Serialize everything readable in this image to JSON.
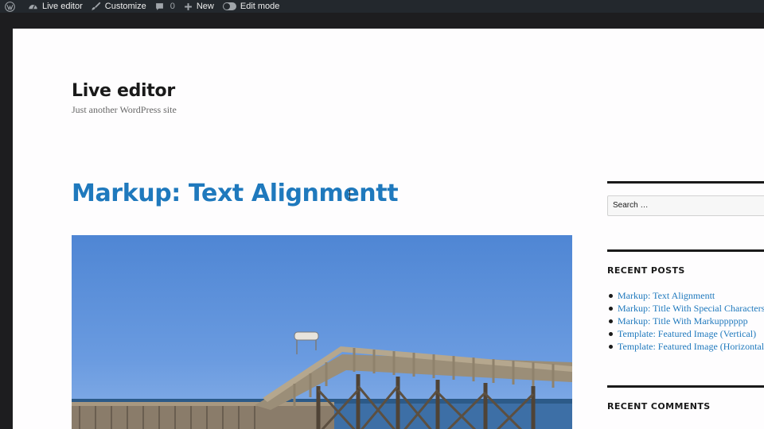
{
  "admin_bar": {
    "wp_icon": "wordpress-logo-icon",
    "site_name": "Live editor",
    "site_icon": "dashboard-icon",
    "customize_label": "Customize",
    "customize_icon": "brush-icon",
    "comments_count": "0",
    "comments_icon": "comment-bubble-icon",
    "new_label": "New",
    "new_icon": "plus-icon",
    "edit_mode_label": "Edit mode",
    "edit_mode_icon": "toggle-icon"
  },
  "site": {
    "title": "Live editor",
    "description": "Just another WordPress site"
  },
  "post": {
    "title": "Markup: Text Alignmentt",
    "featured_image": "pier-boardwalk-photo"
  },
  "sidebar": {
    "search_placeholder": "Search …",
    "recent_posts_title": "RECENT POSTS",
    "recent_posts": [
      "Markup: Text Alignmentt",
      "Markup: Title With Special Characters",
      "Markup: Title With Markupppppp",
      "Template: Featured Image (Vertical)",
      "Template: Featured Image (Horizontal)"
    ],
    "recent_comments_title": "RECENT COMMENTS"
  },
  "colors": {
    "admin_bar_bg": "#23282d",
    "link_blue": "#1f79bd",
    "page_bg": "#fefdfe",
    "text_dark": "#1a1a1a"
  }
}
